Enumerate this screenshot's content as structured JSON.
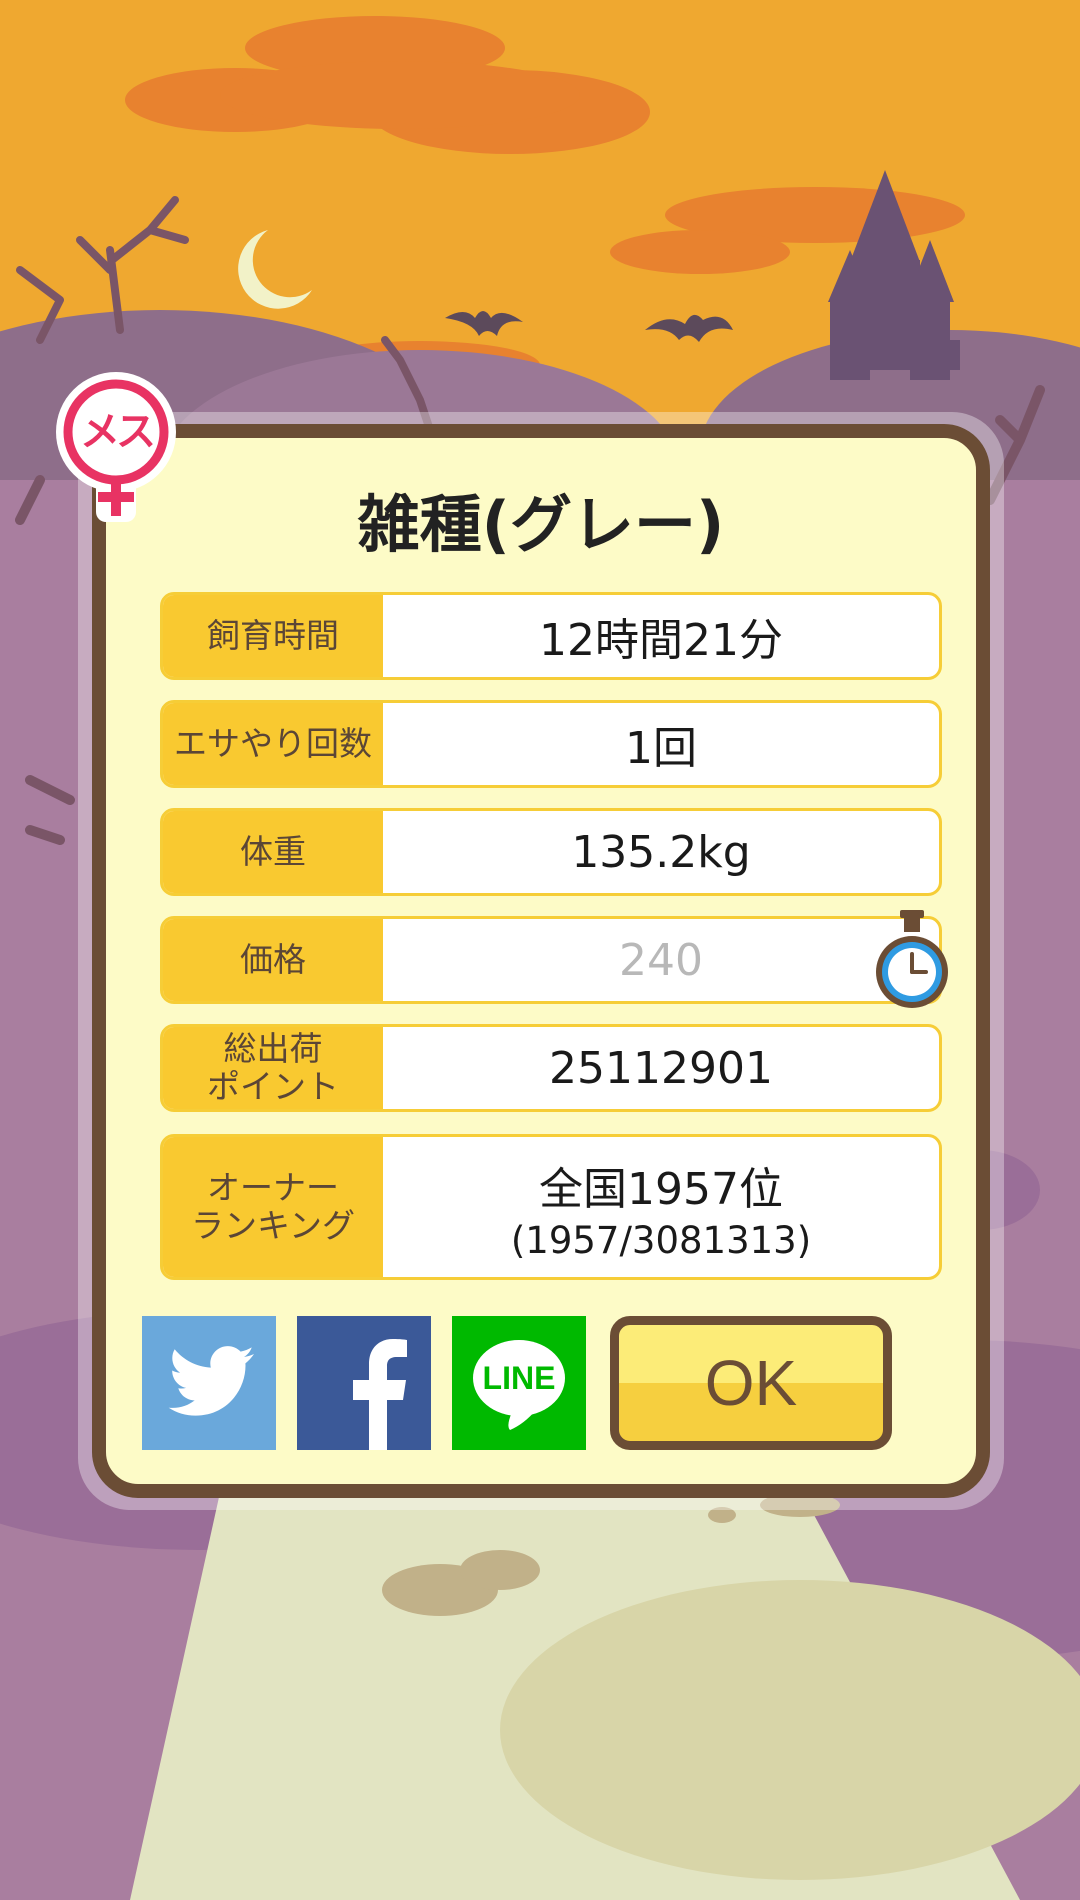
{
  "gender": {
    "label": "メス",
    "color": "#e83363"
  },
  "title": "雑種(グレー)",
  "stats": {
    "time": {
      "label": "飼育時間",
      "value": "12時間21分"
    },
    "feed": {
      "label": "エサやり回数",
      "value": "1回"
    },
    "weight": {
      "label": "体重",
      "value": "135.2kg"
    },
    "price": {
      "label": "価格",
      "value": "240"
    },
    "points": {
      "label_line1": "総出荷",
      "label_line2": "ポイント",
      "value": "25112901"
    },
    "ranking": {
      "label_line1": "オーナー",
      "label_line2": "ランキング",
      "value": "全国1957位",
      "sub": "(1957/3081313)"
    }
  },
  "buttons": {
    "ok": "OK",
    "line": "LINE"
  },
  "icons": {
    "twitter": "twitter-bird-icon",
    "facebook": "facebook-f-icon",
    "line": "line-logo-icon",
    "timer": "stopwatch-icon",
    "gender": "female-symbol-icon"
  },
  "colors": {
    "sky": "#efa830",
    "panel": "#fdfbc7",
    "frame": "#6b4d35",
    "label_bg": "#f9c930",
    "twitter": "#6aa8db",
    "facebook": "#3b5998",
    "line": "#00b900"
  }
}
